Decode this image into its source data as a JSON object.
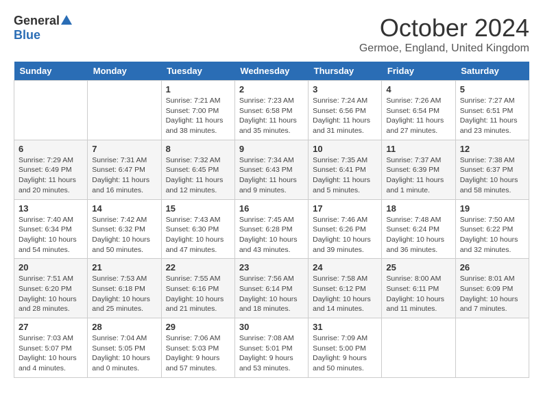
{
  "header": {
    "logo_general": "General",
    "logo_blue": "Blue",
    "month": "October 2024",
    "location": "Germoe, England, United Kingdom"
  },
  "days_of_week": [
    "Sunday",
    "Monday",
    "Tuesday",
    "Wednesday",
    "Thursday",
    "Friday",
    "Saturday"
  ],
  "weeks": [
    [
      {
        "day": "",
        "info": ""
      },
      {
        "day": "",
        "info": ""
      },
      {
        "day": "1",
        "info": "Sunrise: 7:21 AM\nSunset: 7:00 PM\nDaylight: 11 hours and 38 minutes."
      },
      {
        "day": "2",
        "info": "Sunrise: 7:23 AM\nSunset: 6:58 PM\nDaylight: 11 hours and 35 minutes."
      },
      {
        "day": "3",
        "info": "Sunrise: 7:24 AM\nSunset: 6:56 PM\nDaylight: 11 hours and 31 minutes."
      },
      {
        "day": "4",
        "info": "Sunrise: 7:26 AM\nSunset: 6:54 PM\nDaylight: 11 hours and 27 minutes."
      },
      {
        "day": "5",
        "info": "Sunrise: 7:27 AM\nSunset: 6:51 PM\nDaylight: 11 hours and 23 minutes."
      }
    ],
    [
      {
        "day": "6",
        "info": "Sunrise: 7:29 AM\nSunset: 6:49 PM\nDaylight: 11 hours and 20 minutes."
      },
      {
        "day": "7",
        "info": "Sunrise: 7:31 AM\nSunset: 6:47 PM\nDaylight: 11 hours and 16 minutes."
      },
      {
        "day": "8",
        "info": "Sunrise: 7:32 AM\nSunset: 6:45 PM\nDaylight: 11 hours and 12 minutes."
      },
      {
        "day": "9",
        "info": "Sunrise: 7:34 AM\nSunset: 6:43 PM\nDaylight: 11 hours and 9 minutes."
      },
      {
        "day": "10",
        "info": "Sunrise: 7:35 AM\nSunset: 6:41 PM\nDaylight: 11 hours and 5 minutes."
      },
      {
        "day": "11",
        "info": "Sunrise: 7:37 AM\nSunset: 6:39 PM\nDaylight: 11 hours and 1 minute."
      },
      {
        "day": "12",
        "info": "Sunrise: 7:38 AM\nSunset: 6:37 PM\nDaylight: 10 hours and 58 minutes."
      }
    ],
    [
      {
        "day": "13",
        "info": "Sunrise: 7:40 AM\nSunset: 6:34 PM\nDaylight: 10 hours and 54 minutes."
      },
      {
        "day": "14",
        "info": "Sunrise: 7:42 AM\nSunset: 6:32 PM\nDaylight: 10 hours and 50 minutes."
      },
      {
        "day": "15",
        "info": "Sunrise: 7:43 AM\nSunset: 6:30 PM\nDaylight: 10 hours and 47 minutes."
      },
      {
        "day": "16",
        "info": "Sunrise: 7:45 AM\nSunset: 6:28 PM\nDaylight: 10 hours and 43 minutes."
      },
      {
        "day": "17",
        "info": "Sunrise: 7:46 AM\nSunset: 6:26 PM\nDaylight: 10 hours and 39 minutes."
      },
      {
        "day": "18",
        "info": "Sunrise: 7:48 AM\nSunset: 6:24 PM\nDaylight: 10 hours and 36 minutes."
      },
      {
        "day": "19",
        "info": "Sunrise: 7:50 AM\nSunset: 6:22 PM\nDaylight: 10 hours and 32 minutes."
      }
    ],
    [
      {
        "day": "20",
        "info": "Sunrise: 7:51 AM\nSunset: 6:20 PM\nDaylight: 10 hours and 28 minutes."
      },
      {
        "day": "21",
        "info": "Sunrise: 7:53 AM\nSunset: 6:18 PM\nDaylight: 10 hours and 25 minutes."
      },
      {
        "day": "22",
        "info": "Sunrise: 7:55 AM\nSunset: 6:16 PM\nDaylight: 10 hours and 21 minutes."
      },
      {
        "day": "23",
        "info": "Sunrise: 7:56 AM\nSunset: 6:14 PM\nDaylight: 10 hours and 18 minutes."
      },
      {
        "day": "24",
        "info": "Sunrise: 7:58 AM\nSunset: 6:12 PM\nDaylight: 10 hours and 14 minutes."
      },
      {
        "day": "25",
        "info": "Sunrise: 8:00 AM\nSunset: 6:11 PM\nDaylight: 10 hours and 11 minutes."
      },
      {
        "day": "26",
        "info": "Sunrise: 8:01 AM\nSunset: 6:09 PM\nDaylight: 10 hours and 7 minutes."
      }
    ],
    [
      {
        "day": "27",
        "info": "Sunrise: 7:03 AM\nSunset: 5:07 PM\nDaylight: 10 hours and 4 minutes."
      },
      {
        "day": "28",
        "info": "Sunrise: 7:04 AM\nSunset: 5:05 PM\nDaylight: 10 hours and 0 minutes."
      },
      {
        "day": "29",
        "info": "Sunrise: 7:06 AM\nSunset: 5:03 PM\nDaylight: 9 hours and 57 minutes."
      },
      {
        "day": "30",
        "info": "Sunrise: 7:08 AM\nSunset: 5:01 PM\nDaylight: 9 hours and 53 minutes."
      },
      {
        "day": "31",
        "info": "Sunrise: 7:09 AM\nSunset: 5:00 PM\nDaylight: 9 hours and 50 minutes."
      },
      {
        "day": "",
        "info": ""
      },
      {
        "day": "",
        "info": ""
      }
    ]
  ]
}
